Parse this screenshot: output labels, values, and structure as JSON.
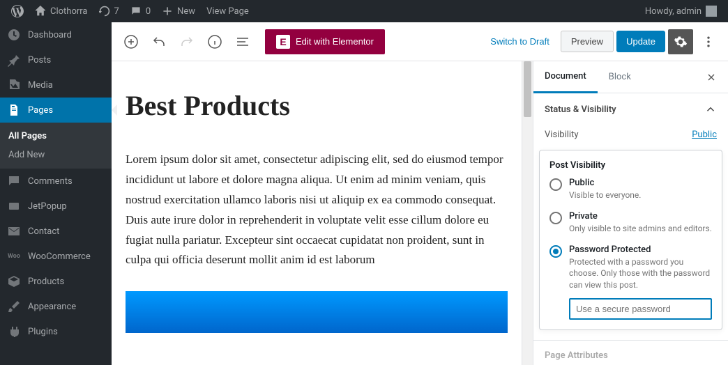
{
  "adminBar": {
    "siteName": "Clothorra",
    "updateCount": "7",
    "commentCount": "0",
    "newLabel": "New",
    "viewPageLabel": "View Page",
    "greeting": "Howdy, admin"
  },
  "sidebar": {
    "dashboard": "Dashboard",
    "posts": "Posts",
    "media": "Media",
    "pages": "Pages",
    "allPages": "All Pages",
    "addNew": "Add New",
    "comments": "Comments",
    "jetPopup": "JetPopup",
    "contact": "Contact",
    "woocommerce": "WooCommerce",
    "products": "Products",
    "appearance": "Appearance",
    "plugins": "Plugins"
  },
  "toolbar": {
    "elementorLabel": "Edit with Elementor",
    "switchDraft": "Switch to Draft",
    "preview": "Preview",
    "update": "Update"
  },
  "content": {
    "title": "Best Products",
    "body": " Lorem ipsum dolor sit amet, consectetur adipiscing elit, sed do eiusmod tempor incididunt ut labore et dolore magna aliqua. Ut enim ad minim veniam, quis nostrud exercitation ullamco laboris nisi ut aliquip ex ea commodo consequat. Duis aute irure dolor in reprehenderit in voluptate velit esse cillum dolore eu fugiat nulla pariatur. Excepteur sint occaecat cupidatat non proident, sunt in culpa qui officia deserunt mollit anim id est laborum"
  },
  "panel": {
    "tabs": {
      "document": "Document",
      "block": "Block"
    },
    "statusSection": "Status & Visibility",
    "visibilityLabel": "Visibility",
    "visibilityValue": "Public",
    "popoverTitle": "Post Visibility",
    "options": {
      "publicLabel": "Public",
      "publicDesc": "Visible to everyone.",
      "privateLabel": "Private",
      "privateDesc": "Only visible to site admins and editors.",
      "passwordLabel": "Password Protected",
      "passwordDesc": "Protected with a password you choose. Only those with the password can view this post."
    },
    "passwordPlaceholder": "Use a secure password",
    "pageAttributes": "Page Attributes"
  }
}
